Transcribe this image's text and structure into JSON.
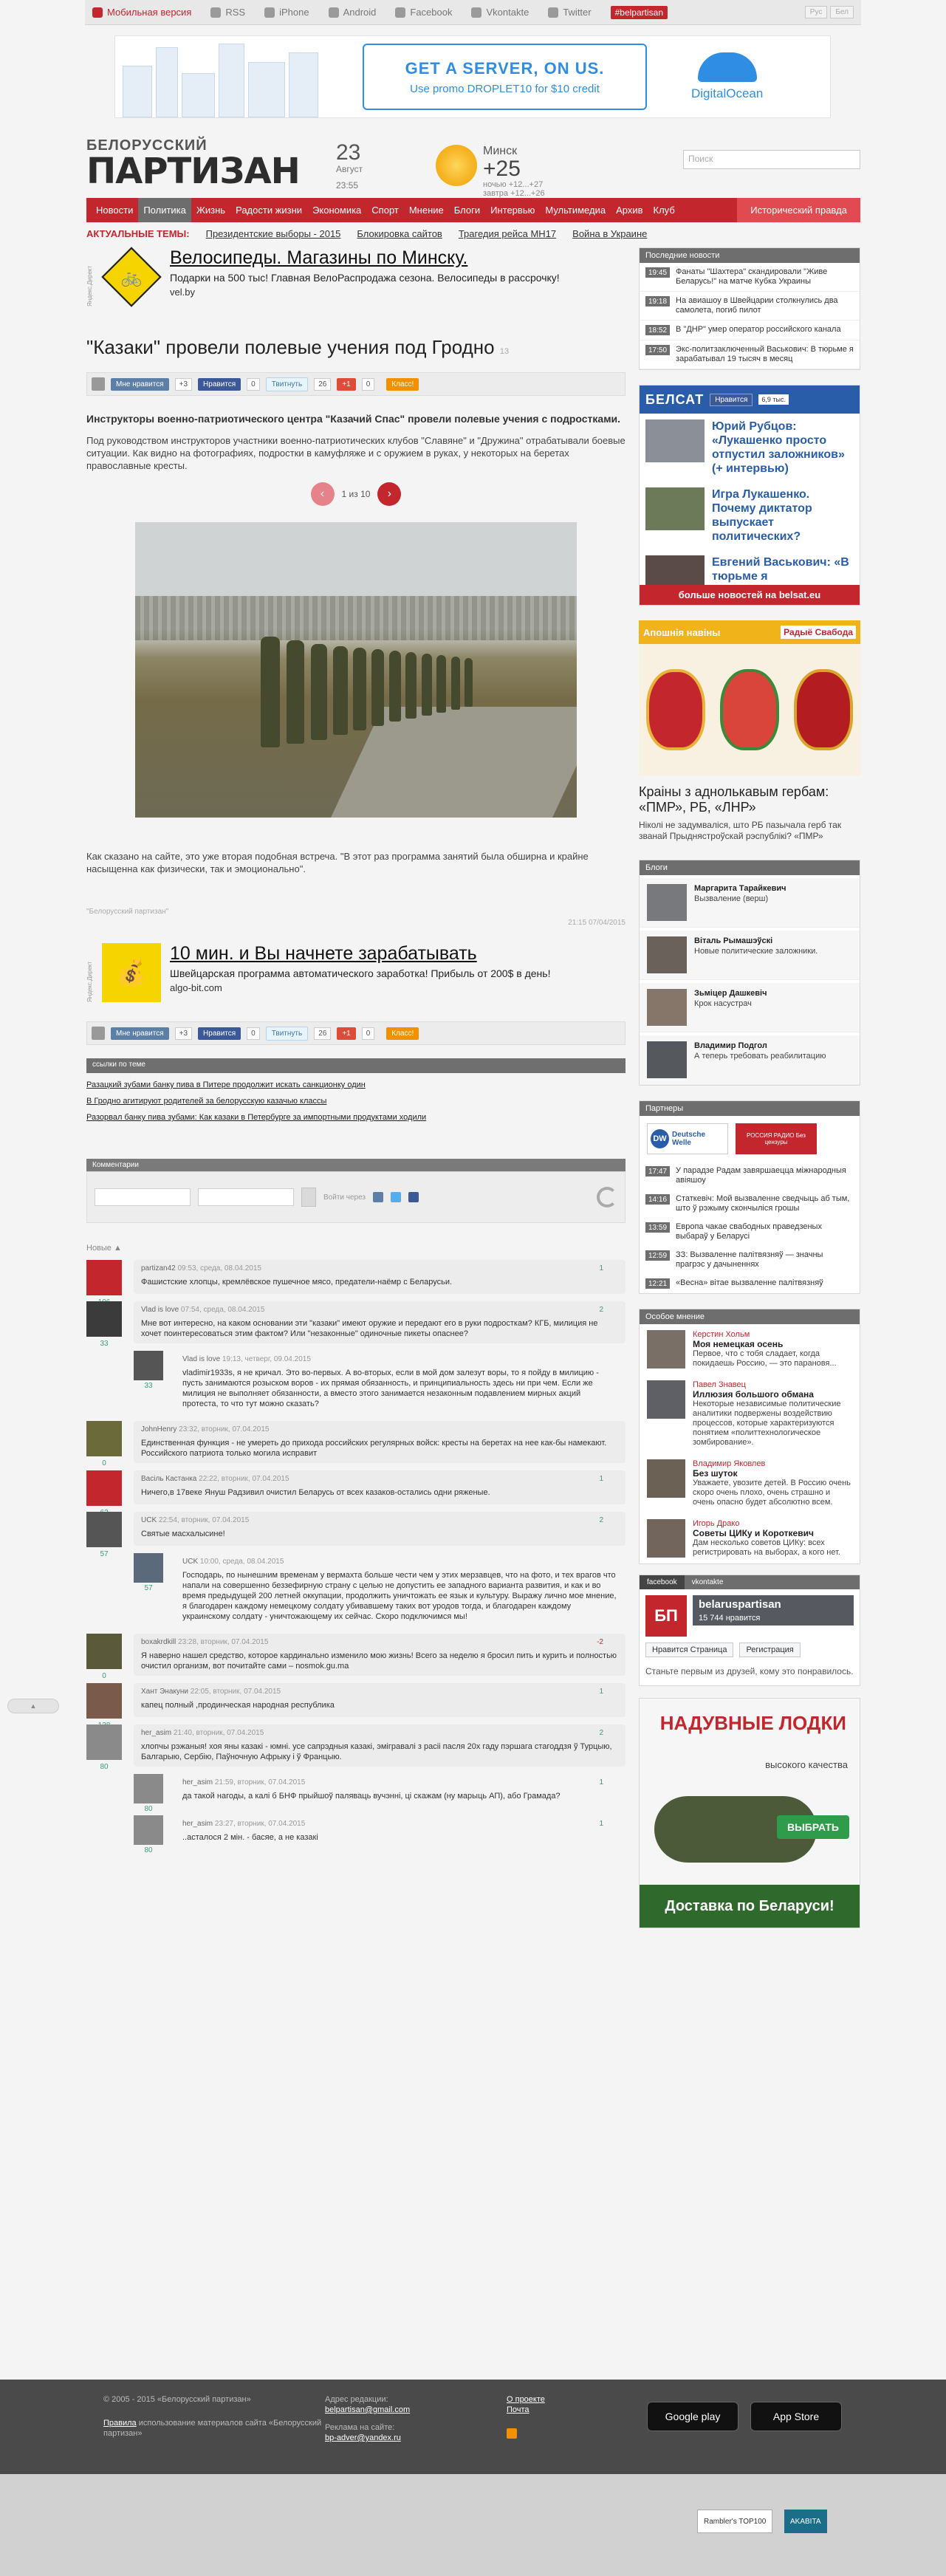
{
  "topbar": {
    "items": [
      "Мобильная версия",
      "RSS",
      "iPhone",
      "Android",
      "Facebook",
      "Vkontakte",
      "Twitter"
    ],
    "tag": "#belpartisan",
    "lang": [
      "Рус",
      "Бел"
    ]
  },
  "ad_top": {
    "headline": "GET A SERVER, ON US.",
    "sub": "Use promo DROPLET10 for $10 credit",
    "brand": "DigitalOcean"
  },
  "header": {
    "logo_top": "БЕЛОРУССКИЙ",
    "logo_main": "ПАРТИЗАН",
    "day": "23",
    "month": "Август",
    "time": "23:55",
    "city": "Минск",
    "temp": "+25",
    "temp_ext": "ночью +12...+27",
    "temp_ext2": "завтра +12...+26",
    "search_placeholder": "Поиск"
  },
  "nav": {
    "items": [
      "Новости",
      "Политика",
      "Жизнь",
      "Радости жизни",
      "Экономика",
      "Спорт",
      "Мнение",
      "Блоги",
      "Интервью",
      "Мультимедиа",
      "Архив",
      "Клуб"
    ],
    "history": "Исторический правда"
  },
  "topics": {
    "label": "АКТУАЛЬНЫЕ ТЕМЫ:",
    "items": [
      "Президентские выборы - 2015",
      "Блокировка сайтов",
      "Трагедия рейса МН17",
      "Война в Украине"
    ]
  },
  "ad1": {
    "label": "Яндекс.Директ",
    "headline": "Велосипеды. Магазины по Минску.",
    "sub": "Подарки на 500 тыс! Главная ВелоРаспродажа сезона. Велосипеды в рассрочку!",
    "url": "vel.by"
  },
  "article": {
    "title": "\"Казаки\" провели полевые учения под Гродно",
    "comment_count": "13",
    "share": {
      "vk": "Мне нравится",
      "vk_count": "+3",
      "fb": "Нравится",
      "fb_count": "0",
      "tw": "Твитнуть",
      "tw_count": "26",
      "gp": "+1",
      "gp_count": "0",
      "ok": "Класс!"
    },
    "lead": "Инструкторы военно-патриотического центра \"Казачий Спас\" провели полевые учения с подростками.",
    "para": "Под руководством инструкторов участники военно-патриотических клубов \"Славяне\" и \"Дружина\" отрабатывали боевые ситуации. Как видно на фотографиях, подростки в камуфляже и с оружием в руках, у некоторых на беретах православные кресты.",
    "pager": "1 из 10",
    "quote": "Как сказано на сайте, это уже вторая подобная встреча. \"В этот раз программа занятий была обширна и крайне насыщенна как физически, так и эмоционально\".",
    "source": "\"Белорусский партизан\"",
    "date": "21:15 07/04/2015"
  },
  "ad2": {
    "label": "Яндекс.Директ",
    "headline": "10 мин. и Вы начнете зарабатывать",
    "sub": "Швейцарская программа автоматического заработка! Прибыль от 200$ в день!",
    "url": "algo-bit.com"
  },
  "related": {
    "heading": "ссылки по теме",
    "links": [
      "Разацкий зубами банку пива в Питере продолжит искать санкционку один",
      "В Гродно агитируют родителей за белорусскую казачью классы",
      "Разорвал банку пива зубами: Как казаки в Петербурге за импортными продуктами ходили"
    ]
  },
  "comments_section": {
    "heading": "Комментарии",
    "via": "Войти через",
    "newest": "Новые",
    "items": [
      {
        "name": "partizan42",
        "date": "09:53, среда, 08.04.2015",
        "score": "106",
        "vote": "1",
        "text": "Фашистские хлопцы, кремлёвское пушечное мясо, предатели-наёмр с Беларусьи.",
        "reply": false
      },
      {
        "name": "Vlad is love",
        "date": "07:54, среда, 08.04.2015",
        "score": "33",
        "vote": "2",
        "text": "Мне вот интересно, на каком основании эти \"казаки\" имеют оружие и передают его в руки подросткам? КГБ, милиция не хочет поинтересоваться этим фактом? Или \"незаконные\" одиночные пикеты опаснее?",
        "reply": false
      },
      {
        "name": "Vlad is love",
        "date": "19:13, четверг, 09.04.2015",
        "score": "33",
        "vote": "",
        "text": "vladimir1933s, я не кричал. Это во-первых. А во-вторых, если в мой дом залезут воры, то я пойду в милицию - пусть занимаются розыском воров - их прямая обязанность, и принципиальность здесь ни при чем. Если же милиция не выполняет обязанности, а вместо этого занимается незаконным подавлением мирных акций протеста, то что тут можно сказать?",
        "reply": true
      },
      {
        "name": "JohnHenry",
        "date": "23:32, вторник, 07.04.2015",
        "score": "0",
        "vote": "",
        "text": "Единственная функция - не умереть до прихода российских регулярных войск: кресты на беретах на нее как-бы намекают. Российского патриота только могила исправит",
        "reply": false
      },
      {
        "name": "Васіль Кастанка",
        "date": "22:22, вторник, 07.04.2015",
        "score": "62",
        "vote": "1",
        "text": "Ничего,в 17веке Януш Радзивил очистил Беларусь от всех казаков-остались одни ряженые.",
        "reply": false
      },
      {
        "name": "UCK",
        "date": "22:54, вторник, 07.04.2015",
        "score": "57",
        "vote": "2",
        "text": "Святые масхалысине!",
        "reply": false
      },
      {
        "name": "UCK",
        "date": "10:00, среда, 08.04.2015",
        "score": "57",
        "vote": "",
        "text": "Господарь, по нынешним временам у вермахта больше чести чем у этих мерзавцев, что на фото, и тех врагов что напали на совершенно беззефирную страну с целью не допустить ее западного варианта развития, и как и во время предыдущей 200 летней оккупации, продолжить уничтожать ее язык и культуру. Выражу лично мое мнение, я благодарен каждому немецкому солдату убивавшему таких вот уродов тогда, и благодарен каждому украинскому солдату - уничтожающему их сейчас. Скоро подключимся мы!",
        "reply": true
      },
      {
        "name": "boxakrdkill",
        "date": "23:28, вторник, 07.04.2015",
        "score": "0",
        "vote": "-2",
        "text": "Я наверно нашел средство, которое кардинально изменило мою жизнь! Всего за неделю я бросил пить и курить и полностью очистил организм, вот почитайте сами – nosmok.gu.ma",
        "reply": false
      },
      {
        "name": "Хант Энакуни",
        "date": "22:05, вторник, 07.04.2015",
        "score": "138",
        "vote": "1",
        "text": "капец полный ,продинческая народная республика",
        "reply": false
      },
      {
        "name": "her_asim",
        "date": "21:40, вторник, 07.04.2015",
        "score": "80",
        "vote": "2",
        "text": "хлопчы рэжаныя! хоя яны казакі - юмні. усе сапрэдныя казакі, эмігравалі з расіі пасля 20х гаду пэршага стагоддзя ў Турцыю, Балгарыю, Сербію, Паўночную Афрыку і ў Францыю.",
        "reply": false
      },
      {
        "name": "her_asim",
        "date": "21:59, вторник, 07.04.2015",
        "score": "80",
        "vote": "1",
        "text": "да такой нагоды, а калі б БНФ прыйшоў паляваць вучэнні, ці скажам (ну марыць АП), або Грамада?",
        "reply": true
      },
      {
        "name": "her_asim",
        "date": "23:27, вторник, 07.04.2015",
        "score": "80",
        "vote": "1",
        "text": "..асталося 2 мін. - басяе, а не казакі",
        "reply": true
      }
    ]
  },
  "sidebar": {
    "latest_heading": "Последние новости",
    "latest": [
      {
        "time": "19:45",
        "text": "Фанаты \"Шахтера\" скандировали \"Живе Беларусь!\" на матче Кубка Украины"
      },
      {
        "time": "19:18",
        "text": "На авиашоу в Швейцарии столкнулись два самолета, погиб пилот"
      },
      {
        "time": "18:52",
        "text": "В \"ДНР\" умер оператор российского канала"
      },
      {
        "time": "17:50",
        "text": "Экс-политзаключенный Васькович: В тюрьме я зарабатывал 19 тысяч в месяц"
      }
    ],
    "belsat": {
      "logo": "БЕЛСАТ",
      "like": "Нравится",
      "count": "6,9 тыс.",
      "items": [
        "Юрий Рубцов: «Лукашенко просто отпустил заложников» (+ интервью)",
        "Игра Лукашенко. Почему диктатор выпускает политических?",
        "Евгений Васькович: «В тюрьме я"
      ],
      "more": "больше новостей на belsat.eu"
    },
    "svaboda": {
      "left": "Апошнія навіны",
      "right": "Радыё Свабода",
      "title": "Краіны з аднолькавым гербам: «ПМР», РБ, «ЛНР»",
      "desc": "Ніколі не задумваліся, што РБ пазычала герб так званай Прыднястроўскай рэспублікі? «ПМР»"
    },
    "blogs_heading": "Блоги",
    "blogs": [
      {
        "name": "Маргарита Тарайкевич",
        "text": "Вызваление (верш)"
      },
      {
        "name": "Віталь Рымашэўскі",
        "text": "Новые политические заложники."
      },
      {
        "name": "Зьміцер Дашкевіч",
        "text": "Крок насустрач"
      },
      {
        "name": "Владимир Подгол",
        "text": "А теперь требовать реабилитацию"
      }
    ],
    "partners_heading": "Партнеры",
    "partners_logos": [
      "Deutsche Welle",
      "РОССИЯ РАДИО Без цензуры"
    ],
    "partners_news": [
      {
        "time": "17:47",
        "text": "У парадзе Радам завяршаецца міжнародныя авіяшоу"
      },
      {
        "time": "14:16",
        "text": "Статкевіч: Мой вызваленне сведчыць аб тым, што ў рэжыму скончыліся грошы"
      },
      {
        "time": "13:59",
        "text": "Европа чакае свабодных праведзеных выбараў у Беларусі"
      },
      {
        "time": "12:59",
        "text": "ЗЗ: Вызваленне палітвязняў — значны прагрэс у дачыненнях"
      },
      {
        "time": "12:21",
        "text": "«Весна» вітае вызваленне палітвязняў"
      }
    ],
    "opinion_heading": "Особое мнение",
    "opinions": [
      {
        "author": "Керстин Хольм",
        "head": "Моя немецкая осень",
        "text": "Первое, что с тобя сладает, когда покидаешь Россию, — это парановя..."
      },
      {
        "author": "Павел Знавец",
        "head": "Иллюзия большого обмана",
        "text": "Некоторые независимые политические аналитики подвержены воздействию процессов, которые характеризуются понятием «политтехнологическое зомбирование»."
      },
      {
        "author": "Владимир Яковлев",
        "head": "Без шуток",
        "text": "Уважаете, увозите детей. В Россию очень скоро очень плохо, очень страшно и очень опасно будет абсолютно всем."
      },
      {
        "author": "Игорь Драко",
        "head": "Советы ЦИКу и Короткевич",
        "text": "Дам несколько советов ЦИКу: всех регистрировать на выборах, а кого нет."
      }
    ],
    "fb": {
      "tabs": [
        "facebook",
        "vkontakte"
      ],
      "name": "belaruspartisan",
      "likes": "15 744 нравится",
      "like_btn": "Нравится Страница",
      "reg_btn": "Регистрация",
      "hint": "Станьте первым из друзей, кому это понравилось."
    },
    "boat": {
      "title": "НАДУВНЫЕ ЛОДКИ",
      "sub": "высокого качества",
      "btn": "ВЫБРАТЬ",
      "bar": "Доставка по Беларуси!"
    }
  },
  "footer": {
    "copy": "© 2005 - 2015 «Белорусский партизан»",
    "rules_link": "Правила",
    "rules_text": "использование материалов сайта «Белорусский партизан»",
    "addr_label": "Адрес редакции:",
    "addr": "belpartisan@gmail.com",
    "ads_label": "Реклама на сайте:",
    "ads": "bp-adver@yandex.ru",
    "about": "О проекте",
    "mail": "Почта",
    "gplay": "Google play",
    "appstore": "App Store",
    "counters": [
      "Rambler's TOP100",
      "AKABITA"
    ]
  }
}
